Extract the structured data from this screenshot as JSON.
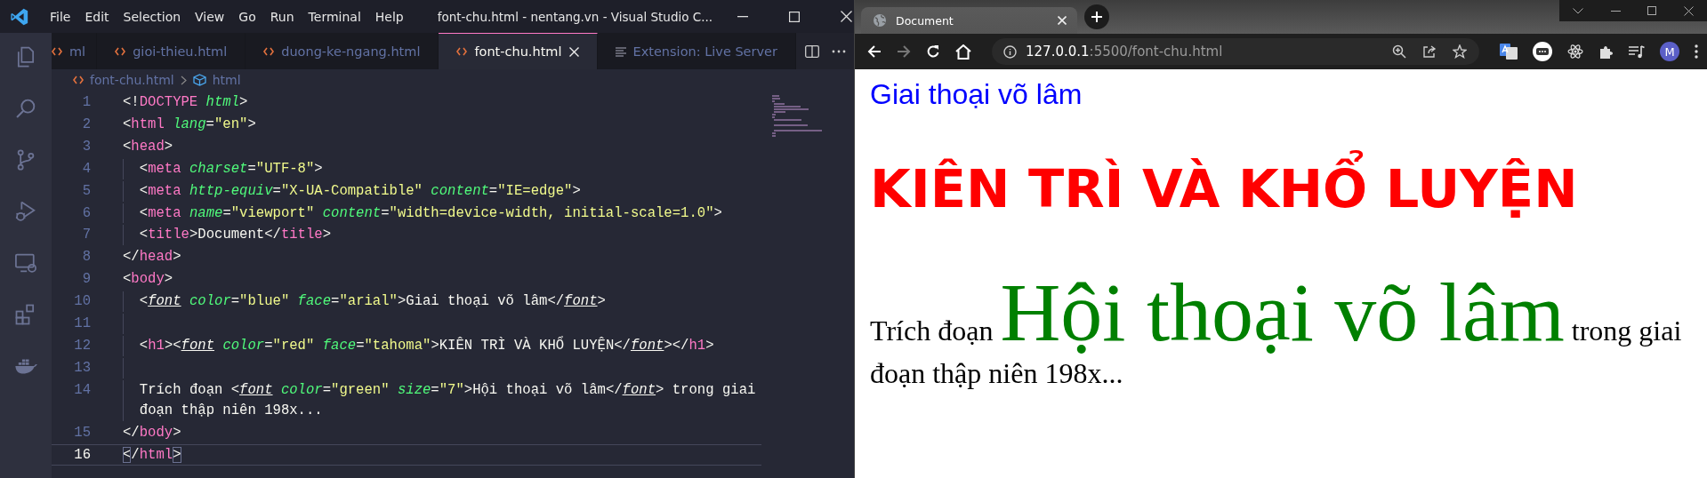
{
  "vscode": {
    "menu": [
      "File",
      "Edit",
      "Selection",
      "View",
      "Go",
      "Run",
      "Terminal",
      "Help"
    ],
    "title": "font-chu.html - nentang.vn - Visual Studio C...",
    "activity": [
      {
        "kind": "files"
      },
      {
        "kind": "search"
      },
      {
        "kind": "source-control"
      },
      {
        "kind": "run"
      },
      {
        "kind": "remote"
      },
      {
        "kind": "extensions"
      },
      {
        "kind": "docker"
      }
    ],
    "tabs": [
      {
        "label": "ml",
        "kind": "html",
        "selected": false
      },
      {
        "label": "gioi-thieu.html",
        "kind": "html",
        "selected": false
      },
      {
        "label": "duong-ke-ngang.html",
        "kind": "html",
        "selected": false
      },
      {
        "label": "font-chu.html",
        "kind": "html",
        "selected": true
      },
      {
        "label": "Extension: Live Server",
        "kind": "preview",
        "selected": false
      }
    ],
    "breadcrumb": {
      "file": "font-chu.html",
      "symbol": "html"
    },
    "lines": [
      {
        "num": "1",
        "indented": false,
        "current": false,
        "tokens": [
          {
            "kind": "p",
            "text": "<!"
          },
          {
            "kind": "tag",
            "text": "DOCTYPE"
          },
          {
            "kind": "attr",
            "text": " html"
          },
          {
            "kind": "p",
            "text": ">"
          }
        ]
      },
      {
        "num": "2",
        "indented": false,
        "current": false,
        "tokens": [
          {
            "kind": "p",
            "text": "<"
          },
          {
            "kind": "tag",
            "text": "html"
          },
          {
            "kind": "attr",
            "text": " lang"
          },
          {
            "kind": "p",
            "text": "="
          },
          {
            "kind": "str",
            "text": "\"en\""
          },
          {
            "kind": "p",
            "text": ">"
          }
        ]
      },
      {
        "num": "3",
        "indented": false,
        "current": false,
        "tokens": [
          {
            "kind": "p",
            "text": "<"
          },
          {
            "kind": "tag",
            "text": "head"
          },
          {
            "kind": "p",
            "text": ">"
          }
        ]
      },
      {
        "num": "4",
        "indented": true,
        "current": false,
        "tokens": [
          {
            "kind": "p",
            "text": "<"
          },
          {
            "kind": "tag",
            "text": "meta"
          },
          {
            "kind": "attr",
            "text": " charset"
          },
          {
            "kind": "p",
            "text": "="
          },
          {
            "kind": "str",
            "text": "\"UTF-8\""
          },
          {
            "kind": "p",
            "text": ">"
          }
        ]
      },
      {
        "num": "5",
        "indented": true,
        "current": false,
        "tokens": [
          {
            "kind": "p",
            "text": "<"
          },
          {
            "kind": "tag",
            "text": "meta"
          },
          {
            "kind": "attr",
            "text": " http-equiv"
          },
          {
            "kind": "p",
            "text": "="
          },
          {
            "kind": "str",
            "text": "\"X-UA-Compatible\""
          },
          {
            "kind": "attr",
            "text": " content"
          },
          {
            "kind": "p",
            "text": "="
          },
          {
            "kind": "str",
            "text": "\"IE=edge\""
          },
          {
            "kind": "p",
            "text": ">"
          }
        ]
      },
      {
        "num": "6",
        "indented": true,
        "current": false,
        "tokens": [
          {
            "kind": "p",
            "text": "<"
          },
          {
            "kind": "tag",
            "text": "meta"
          },
          {
            "kind": "attr",
            "text": " name"
          },
          {
            "kind": "p",
            "text": "="
          },
          {
            "kind": "str",
            "text": "\"viewport\""
          },
          {
            "kind": "attr",
            "text": " content"
          },
          {
            "kind": "p",
            "text": "="
          },
          {
            "kind": "str",
            "text": "\"width=device-width, initial-scale=1.0\""
          },
          {
            "kind": "p",
            "text": ">"
          }
        ]
      },
      {
        "num": "7",
        "indented": true,
        "current": false,
        "tokens": [
          {
            "kind": "p",
            "text": "<"
          },
          {
            "kind": "tag",
            "text": "title"
          },
          {
            "kind": "p",
            "text": ">"
          },
          {
            "kind": "text",
            "text": "Document"
          },
          {
            "kind": "p",
            "text": "</"
          },
          {
            "kind": "tag",
            "text": "title"
          },
          {
            "kind": "p",
            "text": ">"
          }
        ]
      },
      {
        "num": "8",
        "indented": false,
        "current": false,
        "tokens": [
          {
            "kind": "p",
            "text": "</"
          },
          {
            "kind": "tag",
            "text": "head"
          },
          {
            "kind": "p",
            "text": ">"
          }
        ]
      },
      {
        "num": "9",
        "indented": false,
        "current": false,
        "tokens": [
          {
            "kind": "p",
            "text": "<"
          },
          {
            "kind": "tag",
            "text": "body"
          },
          {
            "kind": "p",
            "text": ">"
          }
        ]
      },
      {
        "num": "10",
        "indented": true,
        "current": false,
        "tokens": [
          {
            "kind": "p",
            "text": "<"
          },
          {
            "kind": "dep",
            "text": "font"
          },
          {
            "kind": "attr",
            "text": " color"
          },
          {
            "kind": "p",
            "text": "="
          },
          {
            "kind": "str",
            "text": "\"blue\""
          },
          {
            "kind": "attr",
            "text": " face"
          },
          {
            "kind": "p",
            "text": "="
          },
          {
            "kind": "str",
            "text": "\"arial\""
          },
          {
            "kind": "p",
            "text": ">"
          },
          {
            "kind": "text",
            "text": "Giai thoại võ lâm"
          },
          {
            "kind": "p",
            "text": "</"
          },
          {
            "kind": "dep",
            "text": "font"
          },
          {
            "kind": "p",
            "text": ">"
          }
        ]
      },
      {
        "num": "11",
        "indented": true,
        "current": false
      },
      {
        "num": "12",
        "indented": true,
        "current": false,
        "tokens": [
          {
            "kind": "p",
            "text": "<"
          },
          {
            "kind": "tag",
            "text": "h1"
          },
          {
            "kind": "p",
            "text": "><"
          },
          {
            "kind": "dep",
            "text": "font"
          },
          {
            "kind": "attr",
            "text": " color"
          },
          {
            "kind": "p",
            "text": "="
          },
          {
            "kind": "str",
            "text": "\"red\""
          },
          {
            "kind": "attr",
            "text": " face"
          },
          {
            "kind": "p",
            "text": "="
          },
          {
            "kind": "str",
            "text": "\"tahoma\""
          },
          {
            "kind": "p",
            "text": ">"
          },
          {
            "kind": "text",
            "text": "KIÊN TRÌ VÀ KHỔ LUYỆN"
          },
          {
            "kind": "p",
            "text": "</"
          },
          {
            "kind": "dep",
            "text": "font"
          },
          {
            "kind": "p",
            "text": "></"
          },
          {
            "kind": "tag",
            "text": "h1"
          },
          {
            "kind": "p",
            "text": ">"
          }
        ]
      },
      {
        "num": "13",
        "indented": true,
        "current": false
      },
      {
        "num": "14",
        "indented": true,
        "current": false,
        "tokens": [
          {
            "kind": "text",
            "text": "Trích đoạn "
          },
          {
            "kind": "p",
            "text": "<"
          },
          {
            "kind": "dep",
            "text": "font"
          },
          {
            "kind": "attr",
            "text": " color"
          },
          {
            "kind": "p",
            "text": "="
          },
          {
            "kind": "str",
            "text": "\"green\""
          },
          {
            "kind": "attr",
            "text": " size"
          },
          {
            "kind": "p",
            "text": "="
          },
          {
            "kind": "str",
            "text": "\"7\""
          },
          {
            "kind": "p",
            "text": ">"
          },
          {
            "kind": "text",
            "text": "Hội thoại võ lâm"
          },
          {
            "kind": "p",
            "text": "</"
          },
          {
            "kind": "dep",
            "text": "font"
          },
          {
            "kind": "p",
            "text": ">"
          },
          {
            "kind": "text",
            "text": " trong giai đoạn thập niên 198x..."
          }
        ]
      },
      {
        "num": "15",
        "indented": false,
        "current": false,
        "tokens": [
          {
            "kind": "p",
            "text": "</"
          },
          {
            "kind": "tag",
            "text": "body"
          },
          {
            "kind": "p",
            "text": ">"
          }
        ]
      },
      {
        "num": "16",
        "indented": false,
        "current": true,
        "tokens": [
          {
            "kind": "bm",
            "text": "<"
          },
          {
            "kind": "p",
            "text": "/"
          },
          {
            "kind": "tag",
            "text": "html"
          },
          {
            "kind": "bm",
            "text": ">"
          }
        ]
      }
    ]
  },
  "browser": {
    "tab": "Document",
    "url_host": "127.0.0.1",
    "url_rest": ":5500/font-chu.html",
    "avatar": "M",
    "nav": [
      {
        "kind": "back",
        "disabled": false
      },
      {
        "kind": "forward",
        "disabled": true
      },
      {
        "kind": "reload",
        "disabled": false
      },
      {
        "kind": "home",
        "disabled": false
      }
    ],
    "page": {
      "link_text": "Giai thoại võ lâm",
      "heading": "KIÊN TRÌ VÀ KHỔ LUYỆN",
      "para": {
        "before": "Trích đoạn ",
        "big": "Hội thoại võ lâm",
        "after": " trong giai đoạn thập niên 198x..."
      }
    }
  }
}
